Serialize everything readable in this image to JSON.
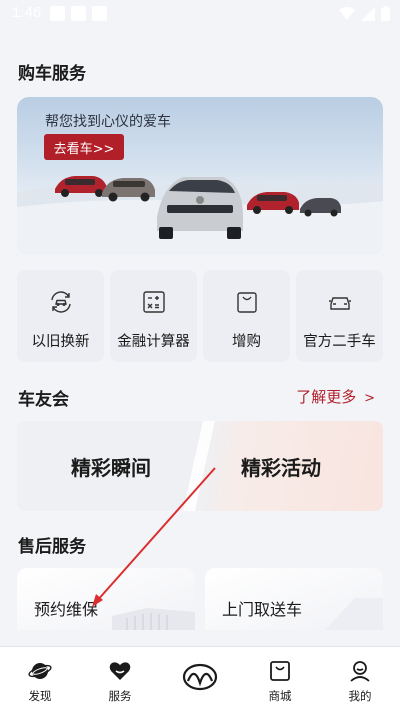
{
  "status_bar": {
    "time": "1:46"
  },
  "sections": {
    "buy_title": "购车服务",
    "club_title": "车友会",
    "after_sales_title": "售后服务"
  },
  "banner": {
    "subtitle": "帮您找到心仪的爱车",
    "cta_label": "去看车>>"
  },
  "services": [
    {
      "label": "以旧换新",
      "icon": "car-swap-icon"
    },
    {
      "label": "金融计算器",
      "icon": "calculator-icon"
    },
    {
      "label": "增购",
      "icon": "shopping-bag-icon"
    },
    {
      "label": "官方二手车",
      "icon": "car-icon"
    }
  ],
  "club": {
    "more_label": "了解更多",
    "more_chevron": ">",
    "moments_label": "精彩瞬间",
    "events_label": "精彩活动"
  },
  "after_sales": {
    "maintenance_label": "预约维保",
    "pickup_label": "上门取送车"
  },
  "nav": [
    {
      "label": "发现",
      "icon": "planet-icon"
    },
    {
      "label": "服务",
      "icon": "heart-icon"
    },
    {
      "label": "",
      "icon": "mazda-logo-icon"
    },
    {
      "label": "商城",
      "icon": "store-icon"
    },
    {
      "label": "我的",
      "icon": "profile-icon"
    }
  ],
  "colors": {
    "accent": "#b11f29",
    "background": "#f3f4f8",
    "annotation_arrow": "#d9302f"
  }
}
